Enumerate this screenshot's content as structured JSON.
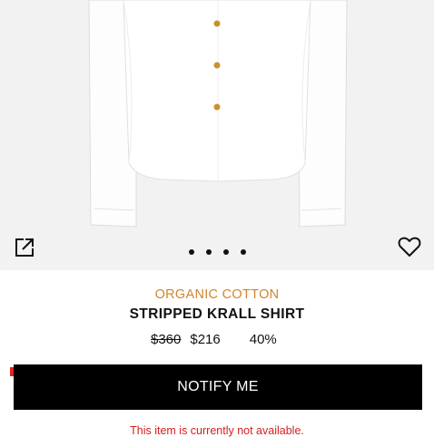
{
  "gallery": {
    "image_alt": "white shirt with gold buttons",
    "share_icon": "share-icon",
    "wishlist_icon": "heart-outline-icon",
    "slide_count": 4
  },
  "product": {
    "category": "ORGANIC COTTON",
    "name": "STRIPPED KRALL SHIRT",
    "original_price": "$360",
    "sale_price": "$216",
    "discount": "40%"
  },
  "actions": {
    "notify_label": "NOTIFY ME"
  },
  "status": {
    "availability": "This item is currently not available."
  },
  "colors": {
    "category": "#d2842c",
    "button_bg": "#000000",
    "alert": "#d62020"
  }
}
